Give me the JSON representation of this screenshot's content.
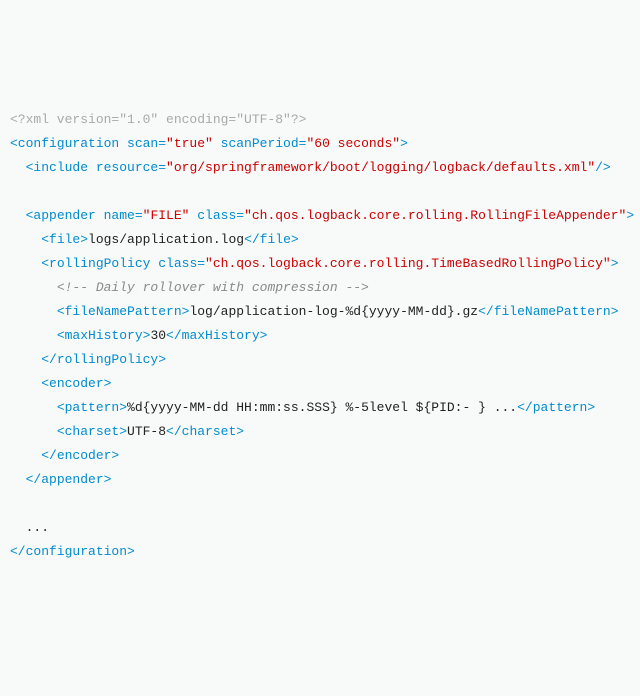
{
  "xmlDecl": "<?xml version=\"1.0\" encoding=\"UTF-8\"?>",
  "cfg": {
    "open": "<configuration scan=",
    "scan": "\"true\"",
    "sep1": " scanPeriod=",
    "scanPeriod": "\"60 seconds\"",
    "openEnd": ">",
    "close": "</configuration>"
  },
  "include": {
    "open": "<include resource=",
    "val": "\"org/springframework/boot/logging/logback/defaults.xml\"",
    "end": "/>"
  },
  "appender": {
    "open": "<appender name=",
    "name": "\"FILE\"",
    "sep": " class=",
    "cls": "\"ch.qos.logback.core.rolling.RollingFileAppender\"",
    "end": ">",
    "close": "</appender>"
  },
  "file": {
    "open": "<file>",
    "val": "logs/application.log",
    "close": "</file>"
  },
  "rolling": {
    "open": "<rollingPolicy class=",
    "cls": "\"ch.qos.logback.core.rolling.TimeBasedRollingPolicy\"",
    "end": ">",
    "comment": "<!-- Daily rollover with compression -->",
    "close": "</rollingPolicy>"
  },
  "fnp": {
    "open": "<fileNamePattern>",
    "val": "log/application-log-%d{yyyy-MM-dd}.gz",
    "close": "</fileNamePattern>"
  },
  "maxHist": {
    "open": "<maxHistory>",
    "val": "30",
    "close": "</maxHistory>"
  },
  "encoder": {
    "open": "<encoder>",
    "close": "</encoder>"
  },
  "pattern": {
    "open": "<pattern>",
    "val": "%d{yyyy-MM-dd HH:mm:ss.SSS} %-5level ${PID:- } ...",
    "close": "</pattern>"
  },
  "charset": {
    "open": "<charset>",
    "val": "UTF-8",
    "close": "</charset>"
  },
  "ellipsis": "..."
}
